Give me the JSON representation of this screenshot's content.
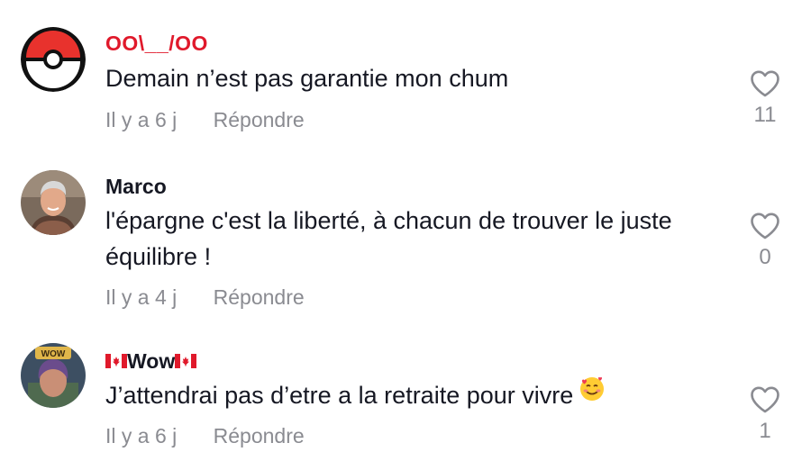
{
  "comments": [
    {
      "username": "OO\\__/OO",
      "text": "Demain n’est pas garantie mon chum",
      "time": "Il y a 6 j",
      "reply_label": "Répondre",
      "likes": "11",
      "avatar_icon": "pokeball-icon"
    },
    {
      "username": "Marco",
      "text": "l'épargne c'est la liberté, à chacun de trouver le juste équilibre !",
      "time": "Il y a 4 j",
      "reply_label": "Répondre",
      "likes": "0",
      "avatar_icon": "user-photo"
    },
    {
      "username": "Wow",
      "text": "J’attendrai pas d’etre a la retraite pour vivre",
      "time": "Il y a 6 j",
      "reply_label": "Répondre",
      "likes": "1",
      "avatar_icon": "user-photo",
      "avatar_badge": "WOW",
      "emoji_icon": "smiling-face-with-hearts-icon"
    }
  ],
  "colors": {
    "username_red": "#e0192b",
    "text": "#161823",
    "muted": "#8a8b91"
  }
}
